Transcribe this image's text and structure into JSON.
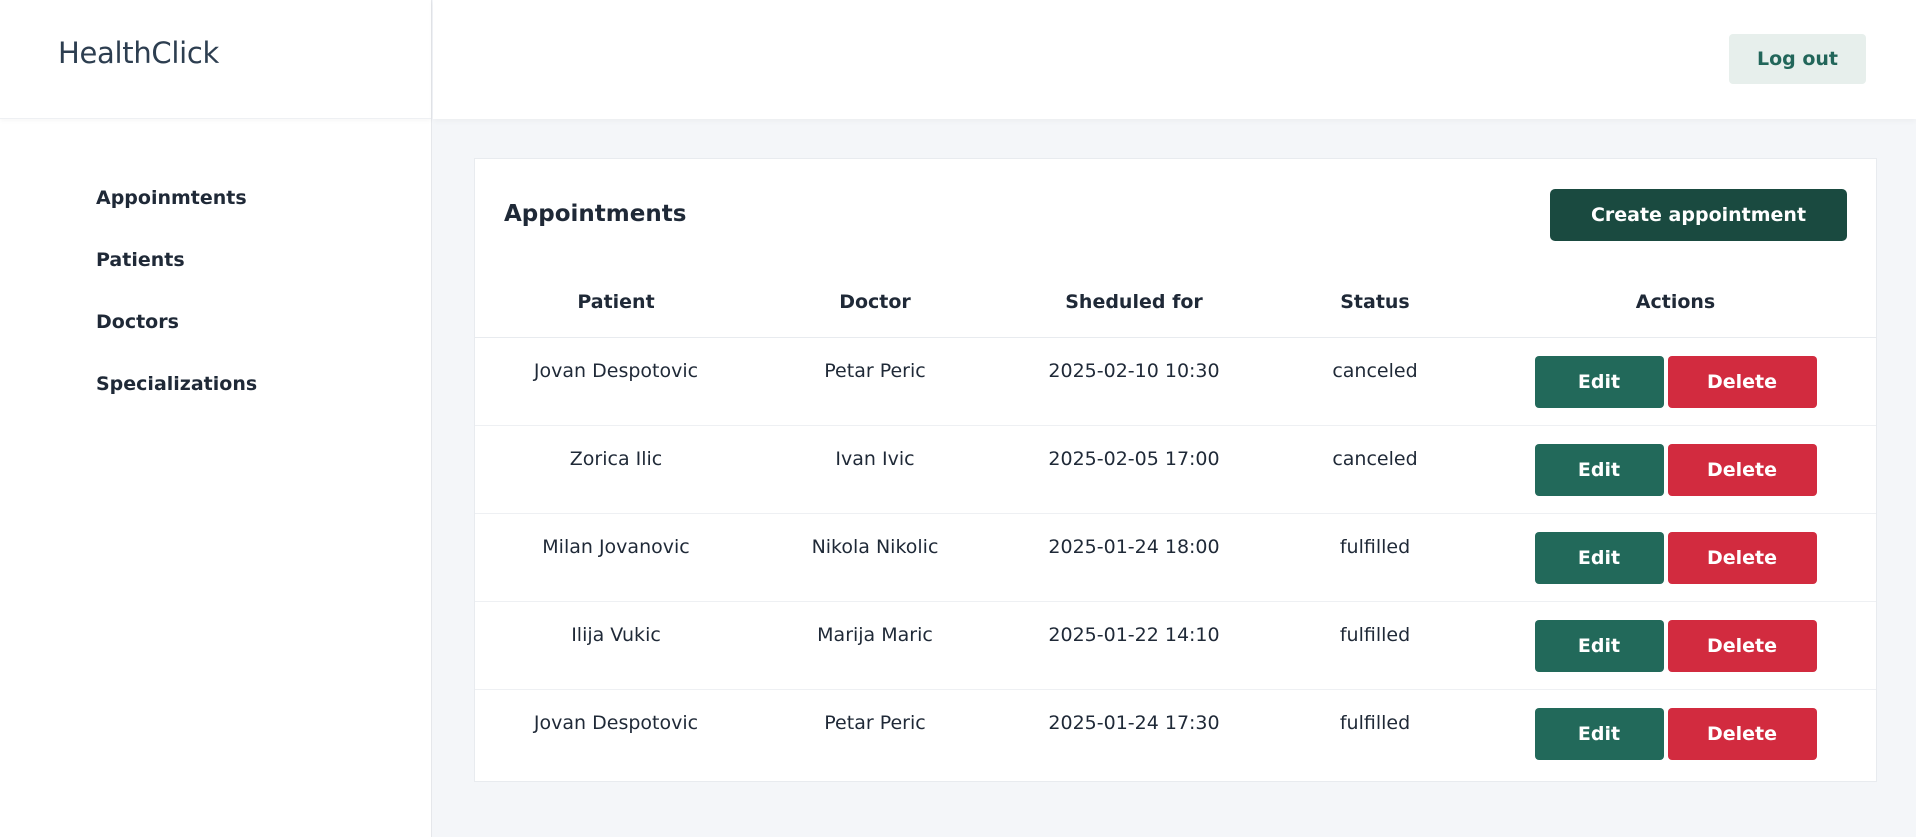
{
  "brand": "HealthClick",
  "nav": [
    "Appoinmtents",
    "Patients",
    "Doctors",
    "Specializations"
  ],
  "topbar": {
    "logout_label": "Log out"
  },
  "card": {
    "title": "Appointments",
    "create_label": "Create appointment"
  },
  "table": {
    "headers": [
      "Patient",
      "Doctor",
      "Sheduled for",
      "Status",
      "Actions"
    ],
    "rows": [
      {
        "patient": "Jovan Despotovic",
        "doctor": "Petar Peric",
        "scheduled": "2025-02-10 10:30",
        "status": "canceled"
      },
      {
        "patient": "Zorica Ilic",
        "doctor": "Ivan Ivic",
        "scheduled": "2025-02-05 17:00",
        "status": "canceled"
      },
      {
        "patient": "Milan Jovanovic",
        "doctor": "Nikola Nikolic",
        "scheduled": "2025-01-24 18:00",
        "status": "fulfilled"
      },
      {
        "patient": "Ilija Vukic",
        "doctor": "Marija Maric",
        "scheduled": "2025-01-22 14:10",
        "status": "fulfilled"
      },
      {
        "patient": "Jovan Despotovic",
        "doctor": "Petar Peric",
        "scheduled": "2025-01-24 17:30",
        "status": "fulfilled"
      }
    ],
    "edit_label": "Edit",
    "delete_label": "Delete"
  },
  "colors": {
    "primary": "#22695a",
    "primary_dark": "#1a4a40",
    "danger": "#d22b3f",
    "background": "#f4f6f9"
  }
}
